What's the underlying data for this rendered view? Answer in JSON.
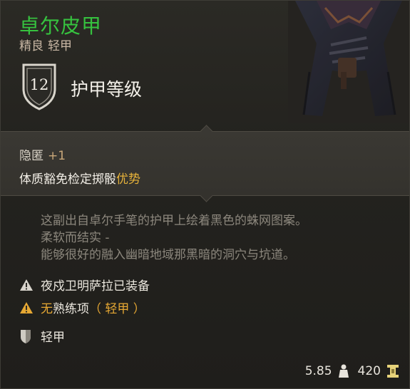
{
  "item": {
    "name": "卓尔皮甲",
    "rarity": "精良",
    "category": "轻甲",
    "armor_class": "12",
    "armor_class_label": "护甲等级"
  },
  "properties": {
    "stealth_label": "隐匿",
    "stealth_value": "+1",
    "advantage_prefix": "体质豁免检定掷骰",
    "advantage_word": "优势"
  },
  "description": {
    "lines": [
      "这副出自卓尔手笔的护甲上绘着黑色的蛛网图案。",
      "柔软而结实 -",
      "能够很好的融入幽暗地域那黑暗的洞穴与坑道。"
    ]
  },
  "requirements": {
    "equipped": "夜戍卫明萨拉已装备",
    "prof_no": "无",
    "prof_rest": "熟练项",
    "prof_type": "（ 轻甲 ）"
  },
  "armor_type": "轻甲",
  "footer": {
    "weight": "5.85",
    "price": "420"
  },
  "colors": {
    "name_green": "#36c23f",
    "advantage_gold": "#e6b23a",
    "warning_orange": "#e6a833"
  },
  "icons": [
    "shield-icon",
    "info-triangle-icon",
    "warning-triangle-icon",
    "armor-type-icon",
    "weight-icon",
    "gold-icon"
  ]
}
